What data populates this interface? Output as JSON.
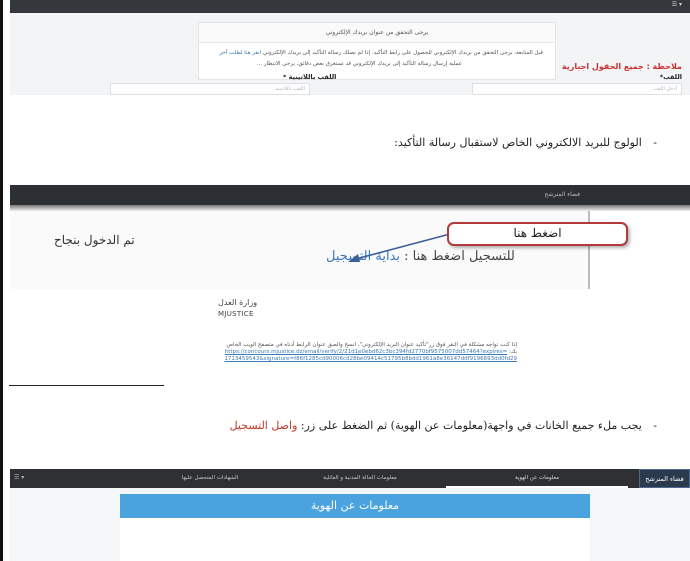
{
  "screenshot1": {
    "menu": "☰ ▾",
    "card_title": "يرجى التحقق من عنوان بريدك الإلكتروني",
    "line1_text": "قبل المتابعة، يرجى التحقق من بريدك الإلكتروني للحصول على رابط التأكيد. إذا لم تصلك رسالة التأكيد إلى بريدك الإلكتروني",
    "line1_link": "انقر هنا لطلب آخر",
    "line2_text": "عملية إرسال رسالة التأكيد إلى بريدك الإلكتروني قد تستغرق بعض دقائق، يرجى الانتظار ..."
  },
  "instruction1": {
    "bullet": "-",
    "text": "الولوج للبريد الالكتروني الخاص لاستقبال رسالة التأكيد:"
  },
  "screenshot2": {
    "bar_label": "فضاء المترشح",
    "success_text": "تم الدخول بنجاح",
    "cta_text": "للتسجيل اضغط هنا : ",
    "cta_link": "بداية التسجيل",
    "click_here": "اضغط هنا"
  },
  "email": {
    "ministry_ar": "وزارة العدل",
    "ministry_en": "MJUSTICE",
    "body_text": "إذا كنت تواجه مشكلة في النقر فوق زر\"تأكيد عنوان البريد الإلكتروني\"، انسخ والصق عنوان الرابط أدناه في متصفح الويب الخاص بك: ",
    "url": "https://concours.mjustice.dz/email/verify/2/21d1e0ebd62c3bc394fd2770bf9575007dd57464?expires=1713459543&signature=f86f1285cd90006cd28be09414c51795b8bdd1961a8e36147ddf9196693dd0fd29"
  },
  "instruction2": {
    "bullet": "-",
    "text": "يجب ملء جميع الخانات في واجهة(معلومات عن الهوية) ثم الضغط على زر: ",
    "button_name": "واصل التسجيل"
  },
  "screenshot3": {
    "brand": "فضاء المترشح",
    "tabs": [
      "معلومات عن الهوية",
      "معلومات الحالة المدنية و العائلية",
      "الشهادات المتحصل عليها"
    ],
    "menu": "☰ ▾",
    "header": "معلومات عن الهوية",
    "note": "ملاحظة : جميع الحقول اجبارية",
    "label_lastname": "اللقب*",
    "label_lastname_latin": "اللقب باللاتينية *",
    "placeholder_lastname": "أدخل اللقب",
    "placeholder_lastname_latin": "اللقب باللاتينية"
  },
  "colors": {
    "accent_red": "#c0392b",
    "link_blue": "#3d7ab8",
    "header_blue": "#4aa3df",
    "dark_nav": "#2e3033"
  }
}
